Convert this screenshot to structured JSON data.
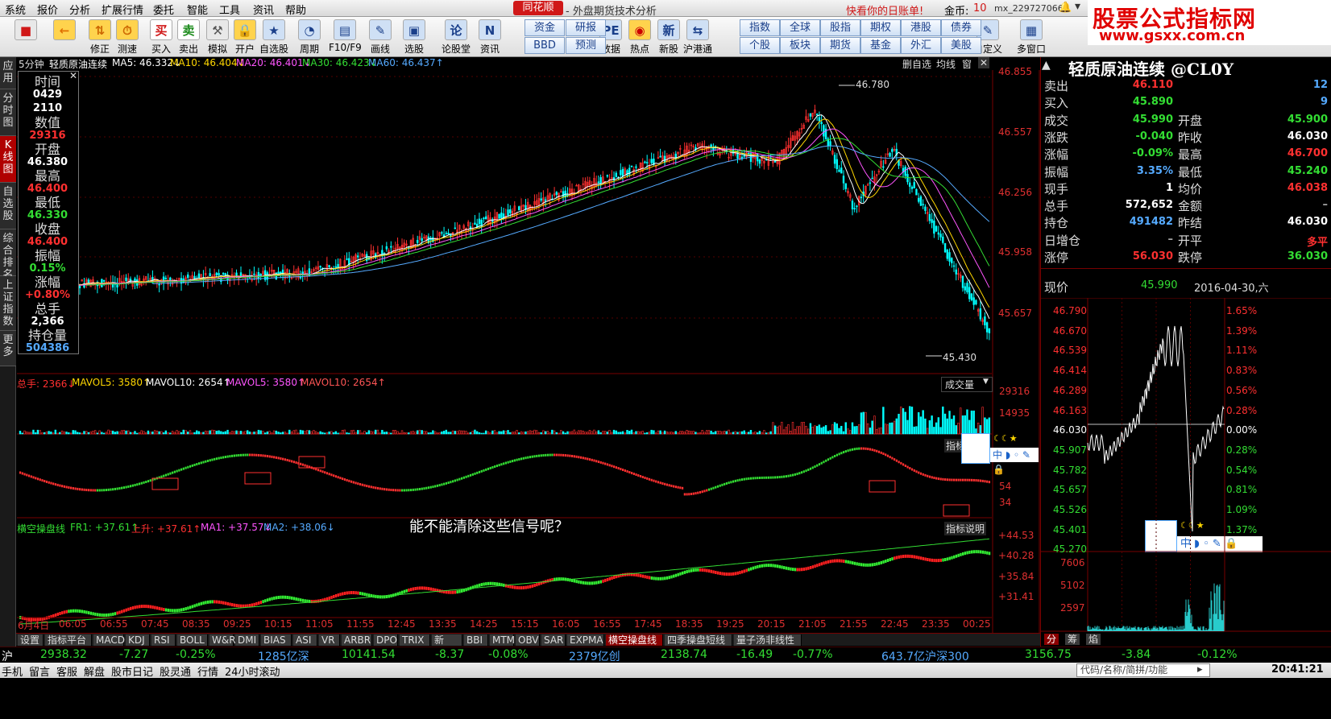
{
  "menu": [
    "系统",
    "报价",
    "分析",
    "扩展行情",
    "委托",
    "智能",
    "工具",
    "资讯",
    "帮助"
  ],
  "brand": "同花顺",
  "app_title": "- 外盘期货技术分析",
  "promo": "快看你的日账单!",
  "coins_label": "金币:",
  "coins_value": "10",
  "user": "mx_229727066",
  "watermark": {
    "title": "股票公式指标网",
    "url": "www.gsxx.com.cn"
  },
  "toolbar": [
    {
      "label": "",
      "icon": "■"
    },
    {
      "label": "",
      "icon": "←"
    },
    {
      "label": "修正",
      "icon": "⇅"
    },
    {
      "label": "测速",
      "icon": "⏱"
    },
    {
      "label": "买入",
      "icon": "买"
    },
    {
      "label": "卖出",
      "icon": "卖"
    },
    {
      "label": "模拟",
      "icon": "⚒"
    },
    {
      "label": "开户",
      "icon": "🔒"
    },
    {
      "label": "自选股",
      "icon": "★"
    },
    {
      "label": "周期",
      "icon": "◔"
    },
    {
      "label": "F10/F9",
      "icon": "▤"
    },
    {
      "label": "画线",
      "icon": "✎"
    },
    {
      "label": "选股",
      "icon": "▣"
    },
    {
      "label": "论股堂",
      "icon": "论"
    },
    {
      "label": "资讯",
      "icon": "N"
    },
    {
      "label": "数据",
      "icon": "PE"
    },
    {
      "label": "热点",
      "icon": "◉"
    },
    {
      "label": "新股",
      "icon": "新"
    },
    {
      "label": "沪港通",
      "icon": "⇆"
    },
    {
      "label": "自定义",
      "icon": "✎"
    },
    {
      "label": "多窗口",
      "icon": "▦"
    }
  ],
  "quick": [
    "资金",
    "BBD",
    "研报",
    "预测",
    "指数",
    "个股",
    "全球",
    "板块",
    "股指",
    "期货",
    "期权",
    "基金",
    "港股",
    "外汇",
    "债券",
    "美股"
  ],
  "vtabs": [
    "应用",
    "分时图",
    "K线图",
    "自选股",
    "综合排名",
    "上证指数",
    "更多"
  ],
  "chart": {
    "period": "5分钟",
    "symbol": "轻质原油连续",
    "ma": [
      {
        "t": "MA5: 46.332↓",
        "c": "#ffffff"
      },
      {
        "t": "MA10: 46.404↓",
        "c": "#ffd700"
      },
      {
        "t": "MA20: 46.401↓",
        "c": "#ff55ff"
      },
      {
        "t": "MA30: 46.423↓",
        "c": "#33dd33"
      },
      {
        "t": "MA60: 46.437↑",
        "c": "#55aaff"
      }
    ],
    "buttons": [
      "删自选",
      "均线",
      "窗",
      "✕"
    ],
    "price_scale": [
      "46.855",
      "46.557",
      "46.256",
      "45.958",
      "45.657"
    ],
    "hi_label": "46.780",
    "lo_label": "45.430",
    "vol_label": "成交量",
    "vol_legend": [
      {
        "t": "总手: 2366↓",
        "c": "#ff3030"
      },
      {
        "t": "MAVOL5: 3580↑",
        "c": "#ffd700"
      },
      {
        "t": "MAVOL10: 2654↑",
        "c": "#ffffff"
      },
      {
        "t": "MAVOL5: 3580↑",
        "c": "#ff55ff"
      },
      {
        "t": "MAVOL10: 2654↑",
        "c": "#ff5555"
      }
    ],
    "vol_scale": [
      "29316",
      "14935"
    ],
    "osc_scale": [
      "54",
      "34"
    ],
    "ind_btn": "指标",
    "question": "能不能清除这些信号呢？",
    "ind2_legend": [
      {
        "t": "横空操盘线",
        "c": "#33dd33"
      },
      {
        "t": "FR1: +37.61↑",
        "c": "#33dd33"
      },
      {
        "t": "上升: +37.61↑",
        "c": "#ff3030"
      },
      {
        "t": "MA1: +37.57↓",
        "c": "#ff55ff"
      },
      {
        "t": "MA2: +38.06↓",
        "c": "#55aaff"
      }
    ],
    "ind2_btn": "指标说明",
    "ind2_scale": [
      "+44.53",
      "+40.28",
      "+35.84",
      "+31.41"
    ],
    "times": [
      "6月4日",
      "06:05",
      "06:55",
      "07:45",
      "08:35",
      "09:25",
      "10:15",
      "11:05",
      "11:55",
      "12:45",
      "13:35",
      "14:25",
      "15:15",
      "16:05",
      "16:55",
      "17:45",
      "18:35",
      "19:25",
      "20:15",
      "21:05",
      "21:55",
      "22:45",
      "23:35",
      "00:25"
    ]
  },
  "info": [
    {
      "k": "时间",
      "v": "0429",
      "c": "#ffffff"
    },
    {
      "k": "",
      "v": "2110",
      "c": "#ffffff"
    },
    {
      "k": "数值",
      "v": "29316",
      "c": "#ff3030"
    },
    {
      "k": "开盘",
      "v": "46.380",
      "c": "#ffffff"
    },
    {
      "k": "最高",
      "v": "46.400",
      "c": "#ff3030"
    },
    {
      "k": "最低",
      "v": "46.330",
      "c": "#33dd33"
    },
    {
      "k": "收盘",
      "v": "46.400",
      "c": "#ff3030"
    },
    {
      "k": "振幅",
      "v": "0.15%",
      "c": "#33dd33"
    },
    {
      "k": "涨幅",
      "v": "+0.80%",
      "c": "#ff3030"
    },
    {
      "k": "总手",
      "v": "2,366",
      "c": "#ffffff"
    },
    {
      "k": "持仓量",
      "v": "504386",
      "c": "#55aaff"
    }
  ],
  "quote": {
    "title": "轻质原油连续 @CL0Y",
    "rows": [
      {
        "a": "卖出",
        "b": "46.110",
        "bc": "#ff3030",
        "c": "",
        "d": "12",
        "dc": "#55aaff"
      },
      {
        "a": "买入",
        "b": "45.890",
        "bc": "#33dd33",
        "c": "",
        "d": "9",
        "dc": "#55aaff"
      },
      {
        "a": "成交",
        "b": "45.990",
        "bc": "#33dd33",
        "c": "开盘",
        "d": "45.900",
        "dc": "#33dd33"
      },
      {
        "a": "涨跌",
        "b": "-0.040",
        "bc": "#33dd33",
        "c": "昨收",
        "d": "46.030",
        "dc": "#ffffff"
      },
      {
        "a": "涨幅",
        "b": "-0.09%",
        "bc": "#33dd33",
        "c": "最高",
        "d": "46.700",
        "dc": "#ff3030"
      },
      {
        "a": "振幅",
        "b": "3.35%",
        "bc": "#55aaff",
        "c": "最低",
        "d": "45.240",
        "dc": "#33dd33"
      },
      {
        "a": "现手",
        "b": "1",
        "bc": "#ffffff",
        "c": "均价",
        "d": "46.038",
        "dc": "#ff3030"
      },
      {
        "a": "总手",
        "b": "572,652",
        "bc": "#ffffff",
        "c": "金额",
        "d": "–",
        "dc": "#aaaaaa"
      },
      {
        "a": "持仓",
        "b": "491482",
        "bc": "#55aaff",
        "c": "昨结",
        "d": "46.030",
        "dc": "#ffffff"
      },
      {
        "a": "日增仓",
        "b": "–",
        "bc": "#aaaaaa",
        "c": "开平",
        "d": "多平",
        "dc": "#ff3030"
      },
      {
        "a": "涨停",
        "b": "56.030",
        "bc": "#ff3030",
        "c": "跌停",
        "d": "36.030",
        "dc": "#33dd33"
      }
    ],
    "now_label": "现价",
    "now_value": "45.990",
    "date": "2016-04-30,六"
  },
  "mini": {
    "left_scale": [
      "46.790",
      "46.670",
      "46.539",
      "46.414",
      "46.289",
      "46.163",
      "46.030",
      "45.907",
      "45.782",
      "45.657",
      "45.526",
      "45.401",
      "45.270"
    ],
    "right_scale": [
      "1.65%",
      "1.39%",
      "1.11%",
      "0.83%",
      "0.56%",
      "0.28%",
      "0.00%",
      "0.28%",
      "0.54%",
      "0.81%",
      "1.09%",
      "1.37%"
    ],
    "vol_scale": [
      "7606",
      "5102",
      "2597"
    ],
    "tabs": [
      "分",
      "筹",
      "焰"
    ]
  },
  "tabs": [
    "设置",
    "指标平台",
    "MACD",
    "KDJ",
    "RSI",
    "BOLL",
    "W&R",
    "DMI",
    "BIAS",
    "ASI",
    "VR",
    "ARBR",
    "DPO",
    "TRIX",
    "新DMA",
    "BBI",
    "MTM",
    "OBV",
    "SAR",
    "EXPMA",
    "横空操盘线",
    "四季操盘短线",
    "量子汤非线性"
  ],
  "active_tab": "横空操盘线",
  "indexbar": [
    {
      "t": "沪",
      "c": "#ffffff"
    },
    {
      "t": "2938.32",
      "c": "#33dd33"
    },
    {
      "t": "-7.27",
      "c": "#33dd33"
    },
    {
      "t": "-0.25%",
      "c": "#33dd33"
    },
    {
      "t": "1285亿深",
      "c": "#55aaff"
    },
    {
      "t": "10141.54",
      "c": "#33dd33"
    },
    {
      "t": "-8.37",
      "c": "#33dd33"
    },
    {
      "t": "-0.08%",
      "c": "#33dd33"
    },
    {
      "t": "2379亿创",
      "c": "#55aaff"
    },
    {
      "t": "2138.74",
      "c": "#33dd33"
    },
    {
      "t": "-16.49",
      "c": "#33dd33"
    },
    {
      "t": "-0.77%",
      "c": "#33dd33"
    },
    {
      "t": "643.7亿沪深300",
      "c": "#55aaff"
    },
    {
      "t": "3156.75",
      "c": "#33dd33"
    },
    {
      "t": "-3.84",
      "c": "#33dd33"
    },
    {
      "t": "-0.12%",
      "c": "#33dd33"
    }
  ],
  "status": [
    "手机",
    "留言",
    "客服",
    "解盘",
    "股市日记",
    "股灵通",
    "行情",
    "24小时滚动"
  ],
  "search_placeholder": "代码/名称/简拼/功能",
  "clock": "20:41:21"
}
